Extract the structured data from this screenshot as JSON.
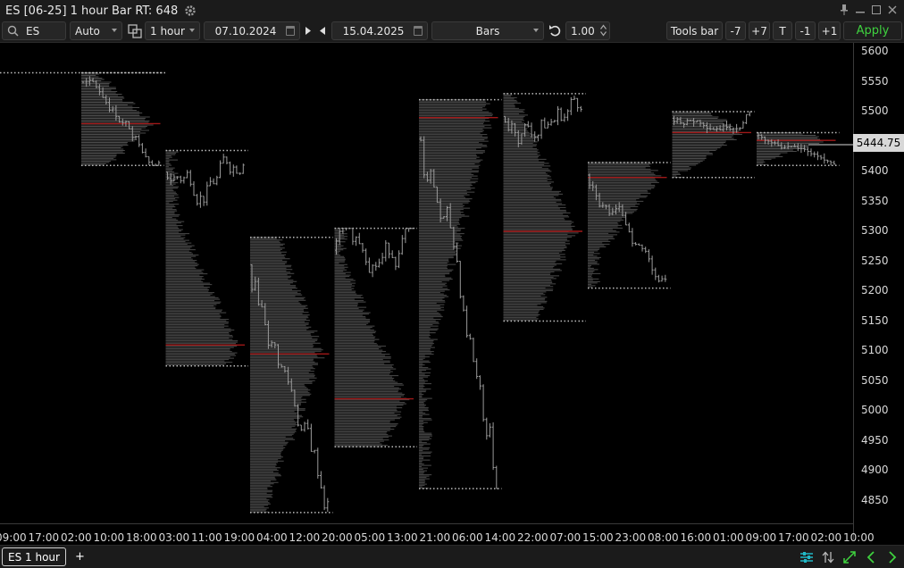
{
  "window": {
    "title": "ES [06-25] 1 hour Bar RT: 648"
  },
  "toolbar": {
    "symbol": "ES",
    "auto": "Auto",
    "interval": "1 hour",
    "from_date": "07.10.2024",
    "to_date": "15.04.2025",
    "chart_type": "Bars",
    "scale": "1.00",
    "tools_bar": "Tools bar",
    "minus7": "-7",
    "plus7": "+7",
    "t": "T",
    "minus1": "-1",
    "plus1": "+1",
    "apply": "Apply"
  },
  "y_axis": {
    "labels": [
      "5600",
      "5550",
      "5500",
      "5450",
      "5400",
      "5350",
      "5300",
      "5250",
      "5200",
      "5150",
      "5100",
      "5050",
      "5000",
      "4950",
      "4900",
      "4850"
    ]
  },
  "last_price": "5444.75",
  "x_axis": {
    "labels": [
      "09:00",
      "17:00",
      "02:00",
      "10:00",
      "18:00",
      "03:00",
      "11:00",
      "19:00",
      "04:00",
      "12:00",
      "20:00",
      "05:00",
      "13:00",
      "21:00",
      "06:00",
      "14:00",
      "22:00",
      "07:00",
      "15:00",
      "23:00",
      "08:00",
      "16:00",
      "01:00",
      "09:00",
      "17:00",
      "02:00",
      "10:00"
    ]
  },
  "tabs": {
    "active": "ES 1 hour",
    "add": "+"
  },
  "colors": {
    "accent_green": "#3fd23f",
    "profile_gray": "#5a5a5a",
    "poc_red": "#a01818",
    "icon_teal": "#21b8c6"
  },
  "chart_data": {
    "type": "bar",
    "symbol": "ES [06-25]",
    "timeframe": "1 hour",
    "ylim": [
      4830,
      5620
    ],
    "profiles": [
      {
        "high": 5565,
        "low": 5410,
        "poc": 5480
      },
      {
        "high": 5435,
        "low": 5075,
        "poc": 5110
      },
      {
        "high": 5290,
        "low": 4830,
        "poc": 5095
      },
      {
        "high": 5305,
        "low": 4940,
        "poc": 5020
      },
      {
        "high": 5520,
        "low": 4870,
        "poc": 5490
      },
      {
        "high": 5530,
        "low": 5150,
        "poc": 5300
      },
      {
        "high": 5415,
        "low": 5205,
        "poc": 5390
      },
      {
        "high": 5500,
        "low": 5390,
        "poc": 5465
      },
      {
        "high": 5465,
        "low": 5410,
        "poc": 5452
      }
    ]
  }
}
